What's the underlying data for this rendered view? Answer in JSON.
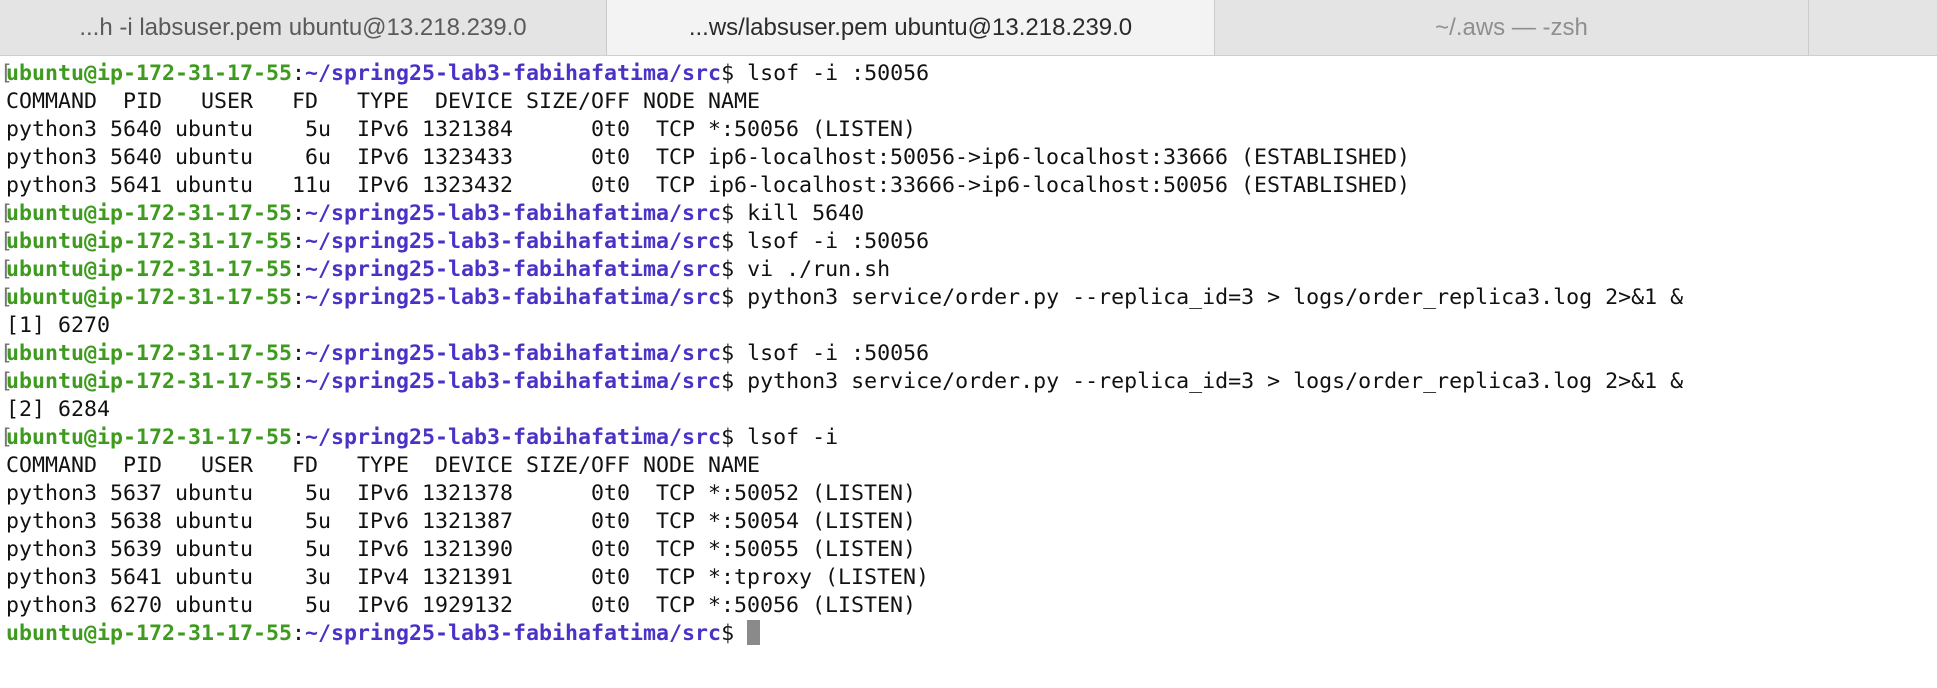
{
  "tabs": [
    {
      "title": "...h -i labsuser.pem ubuntu@13.218.239.0",
      "active": false
    },
    {
      "title": "...ws/labsuser.pem ubuntu@13.218.239.0",
      "active": true
    },
    {
      "title": "~/.aws — -zsh",
      "active": false
    },
    {
      "title": "",
      "active": false
    }
  ],
  "prompt": {
    "user_host": "ubuntu@ip-172-31-17-55",
    "colon": ":",
    "path": "~/spring25-lab3-fabihafatima/src",
    "dollar": "$ "
  },
  "colors": {
    "user_host": "#3f9b1f",
    "path": "#4b32c7",
    "text": "#111111",
    "cursor": "#8a8a8a"
  },
  "lines": [
    {
      "prompt": true,
      "bracket": true,
      "text": "lsof -i :50056"
    },
    {
      "prompt": false,
      "text": "COMMAND  PID   USER   FD   TYPE  DEVICE SIZE/OFF NODE NAME"
    },
    {
      "prompt": false,
      "text": "python3 5640 ubuntu    5u  IPv6 1321384      0t0  TCP *:50056 (LISTEN)"
    },
    {
      "prompt": false,
      "text": "python3 5640 ubuntu    6u  IPv6 1323433      0t0  TCP ip6-localhost:50056->ip6-localhost:33666 (ESTABLISHED)"
    },
    {
      "prompt": false,
      "text": "python3 5641 ubuntu   11u  IPv6 1323432      0t0  TCP ip6-localhost:33666->ip6-localhost:50056 (ESTABLISHED)"
    },
    {
      "prompt": true,
      "bracket": true,
      "text": "kill 5640"
    },
    {
      "prompt": true,
      "bracket": true,
      "text": "lsof -i :50056"
    },
    {
      "prompt": true,
      "bracket": true,
      "text": "vi ./run.sh"
    },
    {
      "prompt": true,
      "bracket": true,
      "text": "python3 service/order.py --replica_id=3 > logs/order_replica3.log 2>&1 &"
    },
    {
      "prompt": false,
      "text": "[1] 6270"
    },
    {
      "prompt": true,
      "bracket": true,
      "text": "lsof -i :50056"
    },
    {
      "prompt": true,
      "bracket": true,
      "text": "python3 service/order.py --replica_id=3 > logs/order_replica3.log 2>&1 &"
    },
    {
      "prompt": false,
      "text": "[2] 6284"
    },
    {
      "prompt": true,
      "bracket": true,
      "text": "lsof -i"
    },
    {
      "prompt": false,
      "text": "COMMAND  PID   USER   FD   TYPE  DEVICE SIZE/OFF NODE NAME"
    },
    {
      "prompt": false,
      "text": "python3 5637 ubuntu    5u  IPv6 1321378      0t0  TCP *:50052 (LISTEN)"
    },
    {
      "prompt": false,
      "text": "python3 5638 ubuntu    5u  IPv6 1321387      0t0  TCP *:50054 (LISTEN)"
    },
    {
      "prompt": false,
      "text": "python3 5639 ubuntu    5u  IPv6 1321390      0t0  TCP *:50055 (LISTEN)"
    },
    {
      "prompt": false,
      "text": "python3 5641 ubuntu    3u  IPv4 1321391      0t0  TCP *:tproxy (LISTEN)"
    },
    {
      "prompt": false,
      "text": "python3 6270 ubuntu    5u  IPv6 1929132      0t0  TCP *:50056 (LISTEN)"
    },
    {
      "prompt": true,
      "bracket": false,
      "text": "",
      "cursor": true
    }
  ]
}
